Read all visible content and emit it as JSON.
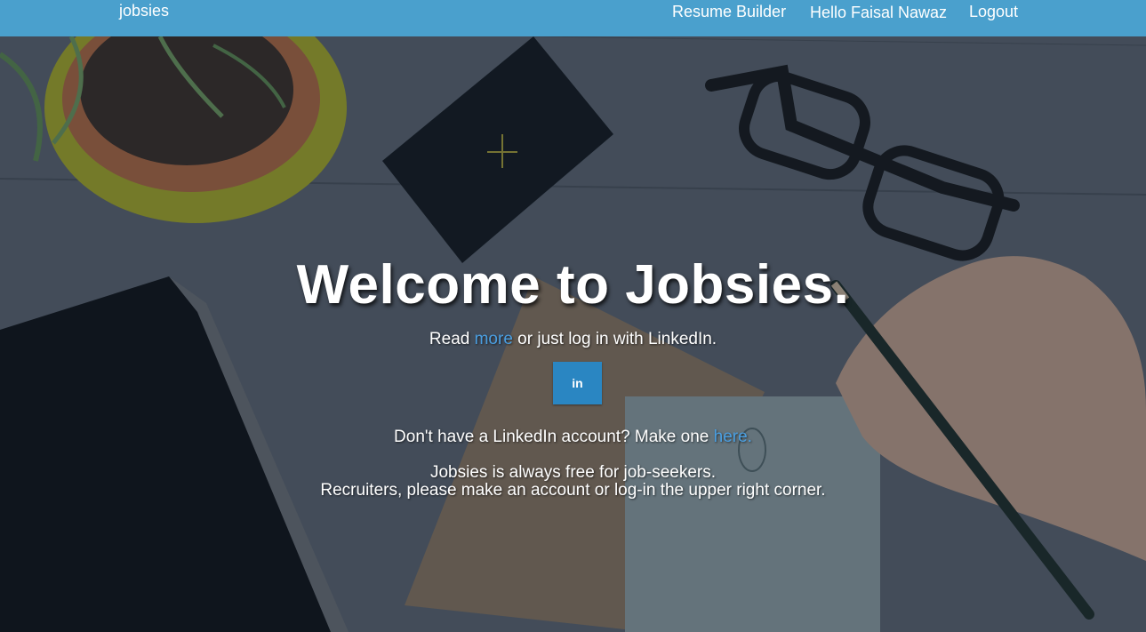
{
  "navbar": {
    "brand": "jobsies",
    "links": {
      "resume_builder": "Resume Builder",
      "greeting": "Hello Faisal Nawaz",
      "logout": "Logout"
    }
  },
  "hero": {
    "title": "Welcome to Jobsies.",
    "read_prefix": "Read ",
    "read_link": "more",
    "read_suffix": " or just log in with LinkedIn.",
    "linkedin_button": "in",
    "no_account_prefix": "Don't have a LinkedIn account? Make one ",
    "no_account_link": "here.",
    "free_line": "Jobsies is always free for job-seekers.",
    "recruiters_line": "Recruiters, please make an account or log-in the upper right corner."
  },
  "colors": {
    "navbar": "#4aa0cd",
    "link": "#4a9ee0",
    "linkedin_button": "#2a86c2"
  }
}
